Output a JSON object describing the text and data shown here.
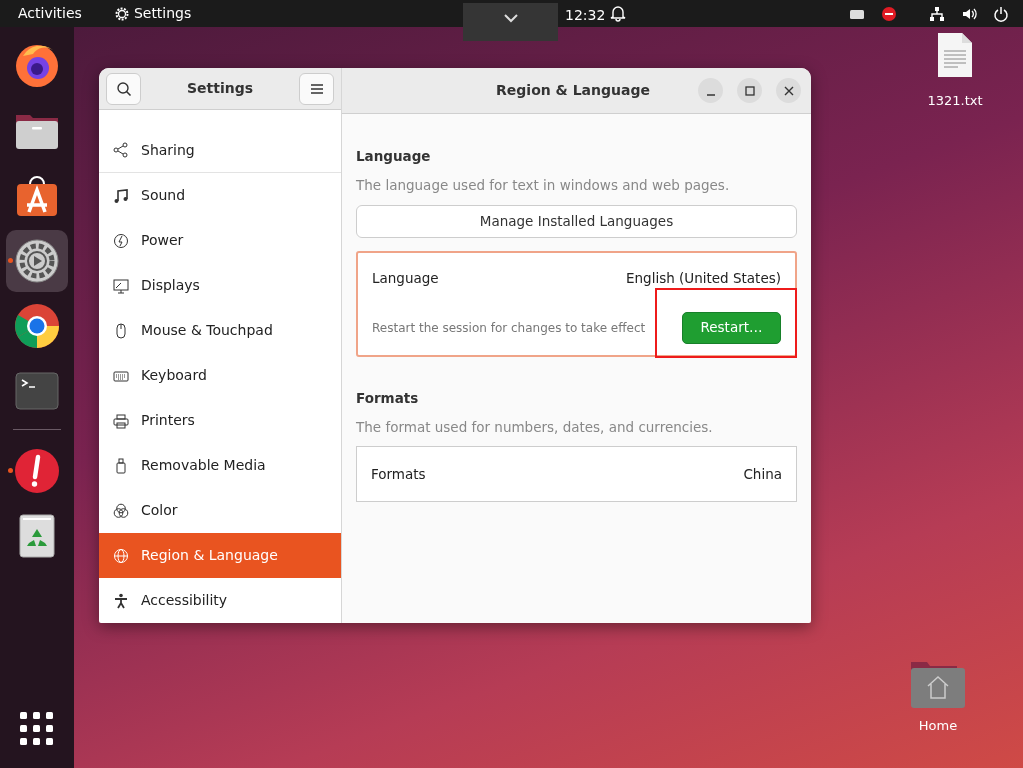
{
  "top_bar": {
    "activities": "Activities",
    "app_menu": "Settings",
    "clock": "12:32",
    "tray": [
      {
        "kind": "keyboard"
      },
      {
        "kind": "blocked"
      },
      {
        "kind": "network"
      },
      {
        "kind": "volume"
      },
      {
        "kind": "power"
      }
    ]
  },
  "dock": {
    "apps": [
      {
        "kind": "firefox",
        "running": false,
        "selected": false
      },
      {
        "kind": "files",
        "running": false,
        "selected": false
      },
      {
        "kind": "store",
        "running": false,
        "selected": false
      },
      {
        "kind": "settings",
        "running": true,
        "selected": true
      },
      {
        "kind": "chrome",
        "running": false,
        "selected": false
      },
      {
        "kind": "terminal",
        "running": false,
        "selected": false
      },
      {
        "kind": "separator"
      },
      {
        "kind": "alert",
        "running": true,
        "selected": false
      },
      {
        "kind": "trash",
        "running": false,
        "selected": false
      }
    ]
  },
  "desktop_icons": [
    {
      "kind": "text-file",
      "label": "1321.txt"
    },
    {
      "kind": "home-folder",
      "label": "Home"
    }
  ],
  "window": {
    "sidebar_title": "Settings",
    "title": "Region & Language",
    "sidebar": {
      "items": [
        {
          "kind": "sharing",
          "label": "Sharing",
          "selected": false
        },
        {
          "kind": "sound",
          "label": "Sound",
          "selected": false
        },
        {
          "kind": "power",
          "label": "Power",
          "selected": false
        },
        {
          "kind": "displays",
          "label": "Displays",
          "selected": false
        },
        {
          "kind": "mouse",
          "label": "Mouse & Touchpad",
          "selected": false
        },
        {
          "kind": "keyboard",
          "label": "Keyboard",
          "selected": false
        },
        {
          "kind": "printers",
          "label": "Printers",
          "selected": false
        },
        {
          "kind": "media",
          "label": "Removable Media",
          "selected": false
        },
        {
          "kind": "color",
          "label": "Color",
          "selected": false
        },
        {
          "kind": "region",
          "label": "Region & Language",
          "selected": true
        },
        {
          "kind": "accessibility",
          "label": "Accessibility",
          "selected": false
        }
      ]
    },
    "language": {
      "heading": "Language",
      "description": "The language used for text in windows and web pages.",
      "manage_button": "Manage Installed Languages",
      "row_label": "Language",
      "row_value": "English (United States)",
      "note": "Restart the session for changes to take effect",
      "restart_button": "Restart…",
      "highlighted": true
    },
    "formats": {
      "heading": "Formats",
      "description": "The format used for numbers, dates, and currencies.",
      "row_label": "Formats",
      "row_value": "China"
    }
  }
}
